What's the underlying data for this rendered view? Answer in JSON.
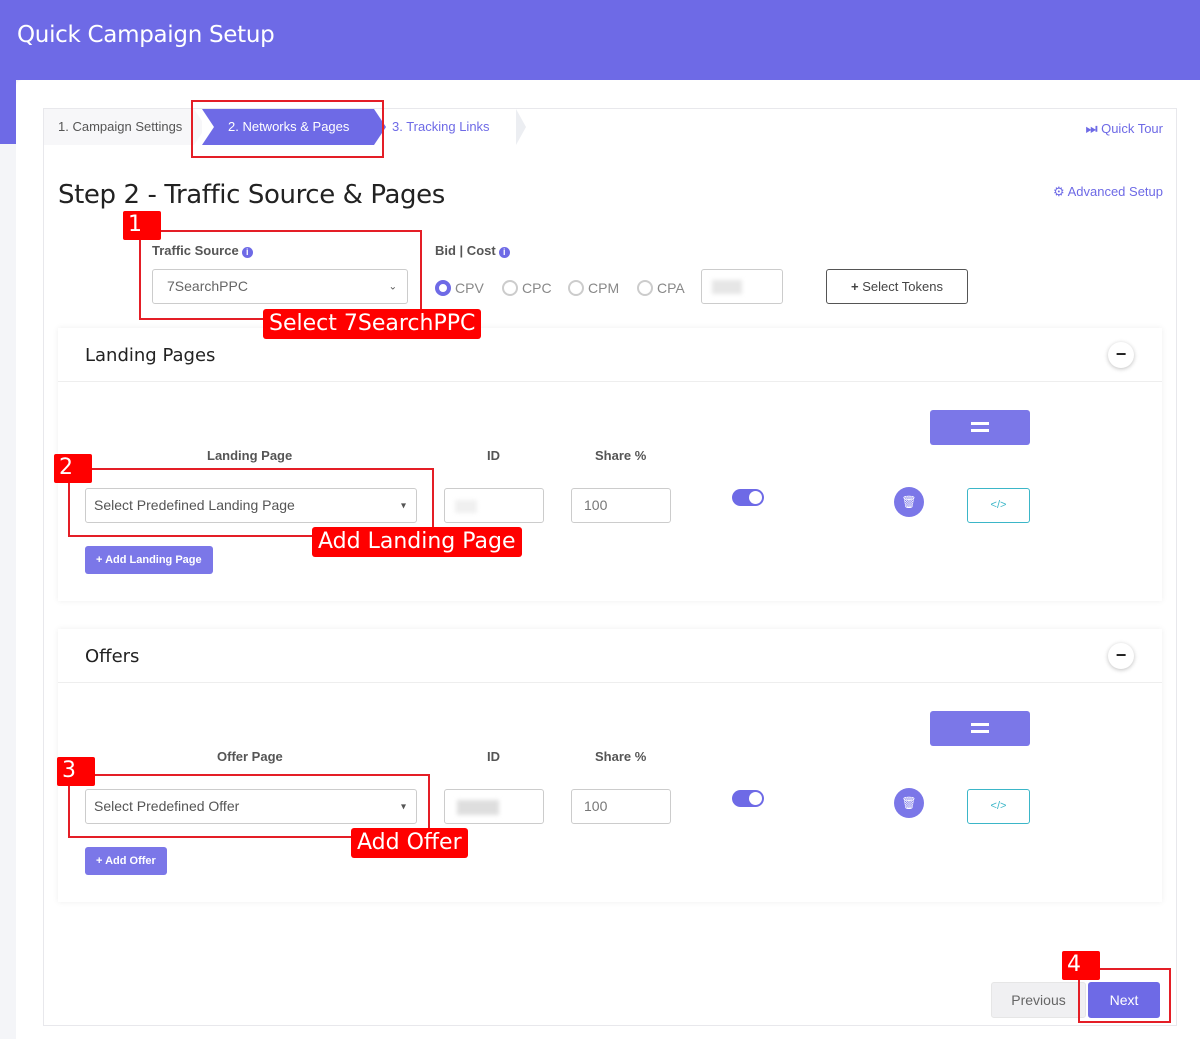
{
  "header": {
    "title": "Quick Campaign Setup"
  },
  "wizard": {
    "steps": [
      "1. Campaign Settings",
      "2. Networks & Pages",
      "3. Tracking Links"
    ],
    "quick_tour": "Quick Tour",
    "advanced_setup": "Advanced Setup"
  },
  "page_title": "Step 2 - Traffic Source & Pages",
  "traffic_source": {
    "label": "Traffic Source",
    "value": "7SearchPPC"
  },
  "bid": {
    "label": "Bid | Cost",
    "options": [
      "CPV",
      "CPC",
      "CPM",
      "CPA"
    ],
    "selected": "CPV",
    "select_tokens": "Select Tokens"
  },
  "landing_pages": {
    "title": "Landing Pages",
    "collapse": "−",
    "columns": {
      "page": "Landing Page",
      "id": "ID",
      "share": "Share %"
    },
    "select_placeholder": "Select Predefined Landing Page",
    "share_value": "100",
    "add_label": "+ Add Landing Page"
  },
  "offers": {
    "title": "Offers",
    "collapse": "−",
    "columns": {
      "page": "Offer Page",
      "id": "ID",
      "share": "Share %"
    },
    "select_placeholder": "Select Predefined Offer",
    "share_value": "100",
    "add_label": "+ Add Offer"
  },
  "footer": {
    "previous": "Previous",
    "next": "Next"
  },
  "annotations": {
    "badges": [
      "1",
      "2",
      "3",
      "4"
    ],
    "callouts": [
      "Select 7SearchPPC",
      "Add Landing Page",
      "Add Offer"
    ],
    "color": "#ff0000"
  },
  "colors": {
    "accent": "#6e6ae6",
    "code_button": "#3bb6c8"
  },
  "icons": {
    "quick_tour": "fast-forward-icon",
    "advanced_setup": "gear-icon",
    "info": "info-icon",
    "select_tokens": "plus-icon",
    "trash": "trash-icon",
    "code": "code-icon",
    "equals": "equals-icon"
  }
}
